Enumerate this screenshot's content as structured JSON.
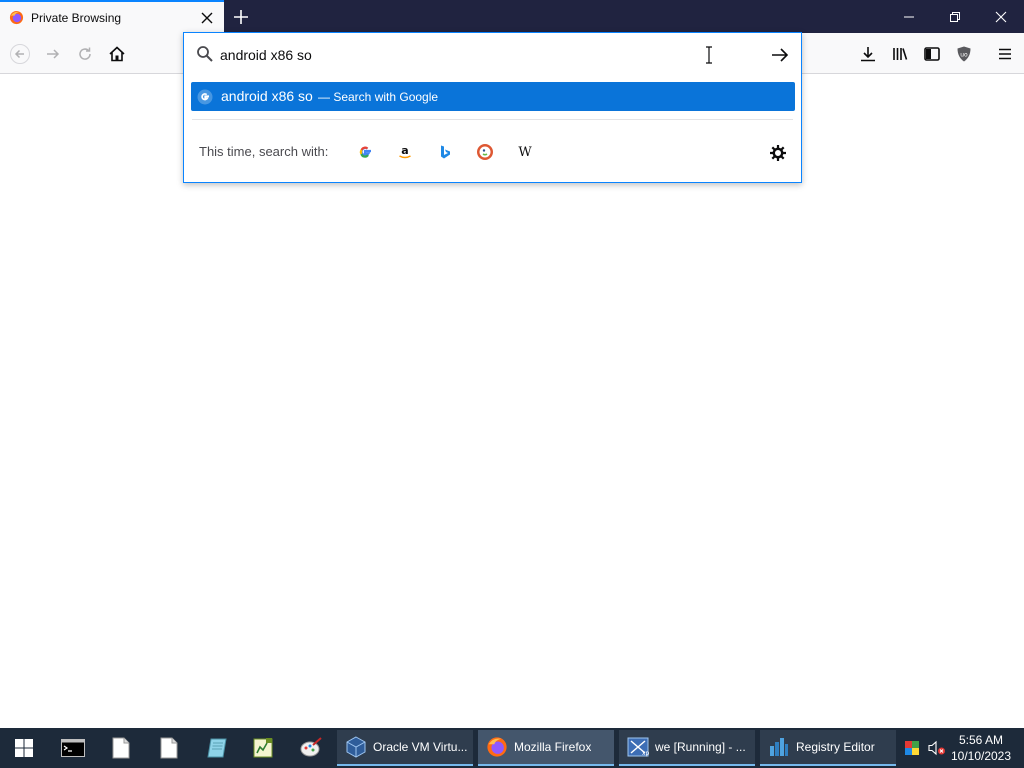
{
  "tab": {
    "title": "Private Browsing"
  },
  "urlbar": {
    "value": "android x86 so"
  },
  "result": {
    "query": "android x86 so",
    "action": "— Search with Google"
  },
  "one_off": {
    "label": "This time, search with:",
    "engines": [
      "google-icon",
      "amazon-icon",
      "bing-icon",
      "duckduckgo-icon",
      "wikipedia-icon"
    ]
  },
  "taskbar": {
    "tasks": [
      {
        "label": "Oracle VM Virtu...",
        "icon": "virtualbox-icon"
      },
      {
        "label": "Mozilla Firefox",
        "icon": "firefox-icon"
      },
      {
        "label": "we [Running] - ...",
        "icon": "vm-running-icon"
      },
      {
        "label": "Registry Editor",
        "icon": "registry-editor-icon"
      }
    ],
    "time": "5:56 AM",
    "date": "10/10/2023"
  },
  "colors": {
    "accent": "#0a84ff",
    "selection": "#0a74d9",
    "titlebar": "#202340",
    "taskbar": "#1d2a3a"
  }
}
